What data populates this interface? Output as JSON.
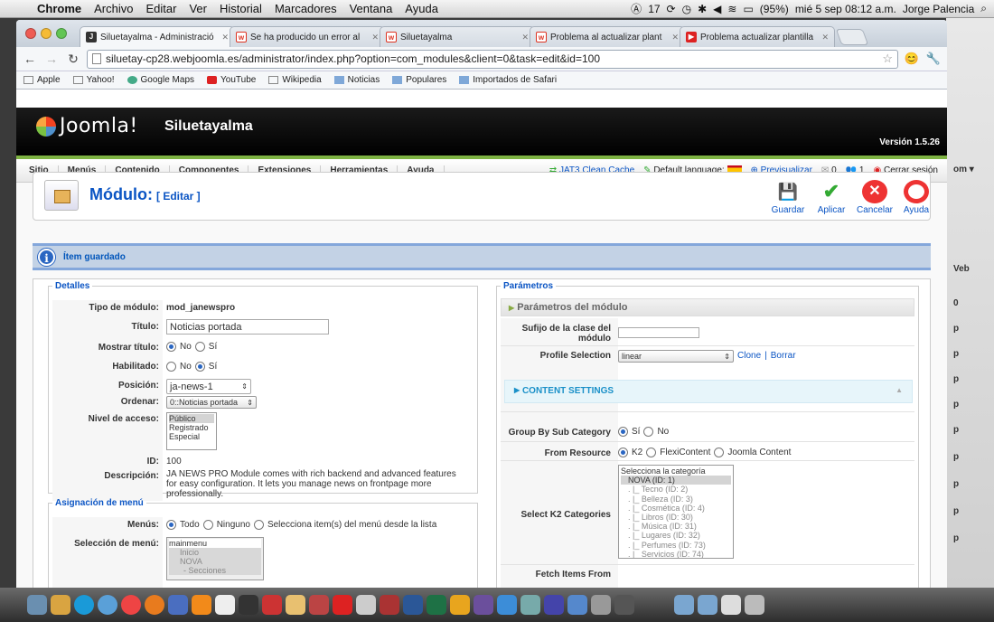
{
  "mac_menu": {
    "app": "Chrome",
    "items": [
      "Archivo",
      "Editar",
      "Ver",
      "Historial",
      "Marcadores",
      "Ventana",
      "Ayuda"
    ],
    "status": {
      "battery": "(95%)",
      "date": "mié 5 sep  08:12 a.m.",
      "user": "Jorge Palencia",
      "num": "17"
    }
  },
  "tabs": [
    {
      "title": "Siluetayalma - Administració",
      "icon": "joomla-favicon-icon"
    },
    {
      "title": "Se ha producido un error al",
      "icon": "w-favicon-icon"
    },
    {
      "title": "Siluetayalma",
      "icon": "w-favicon-icon"
    },
    {
      "title": "Problema al actualizar plant",
      "icon": "w-favicon-icon"
    },
    {
      "title": "Problema actualizar plantilla",
      "icon": "youtube-favicon-icon"
    }
  ],
  "url": "siluetay-cp28.webjoomla.es/administrator/index.php?option=com_modules&client=0&task=edit&id=100",
  "bookmarks": [
    "Apple",
    "Yahoo!",
    "Google Maps",
    "YouTube",
    "Wikipedia",
    "Noticias",
    "Populares",
    "Importados de Safari"
  ],
  "joomla": {
    "logo": "Joomla!",
    "site": "Siluetayalma",
    "version": "Versión 1.5.26",
    "menu": [
      "Sitio",
      "Menús",
      "Contenido",
      "Componentes",
      "Extensiones",
      "Herramientas",
      "Ayuda"
    ],
    "right": {
      "cache": "JAT3 Clean Cache",
      "lang": "Default language:",
      "preview": "Previsualizar",
      "msgs": "0",
      "users": "1",
      "logout": "Cerrar sesión"
    }
  },
  "toolbar": {
    "title": "Módulo:",
    "sub": "[ Editar ]",
    "save": "Guardar",
    "apply": "Aplicar",
    "cancel": "Cancelar",
    "help": "Ayuda"
  },
  "message": "Ítem guardado",
  "details": {
    "legend": "Detalles",
    "type_label": "Tipo de módulo:",
    "type": "mod_janewspro",
    "title_label": "Título:",
    "title": "Noticias portada",
    "show_title_label": "Mostrar título:",
    "no": "No",
    "yes": "Sí",
    "enabled_label": "Habilitado:",
    "position_label": "Posición:",
    "position": "ja-news-1",
    "order_label": "Ordenar:",
    "order": "0::Noticias portada",
    "access_label": "Nivel de acceso:",
    "access_options": [
      "Público",
      "Registrado",
      "Especial"
    ],
    "id_label": "ID:",
    "id": "100",
    "desc_label": "Descripción:",
    "desc": "JA NEWS PRO Module comes with rich backend and advanced features for easy configuration. It lets you manage news on frontpage more professionally."
  },
  "menu_assign": {
    "legend": "Asignación de menú",
    "menus_label": "Menús:",
    "all": "Todo",
    "none": "Ninguno",
    "select": "Selecciona item(s) del menú desde la lista",
    "selection_label": "Selección de menú:",
    "items": [
      "mainmenu",
      "Inicio",
      "NOVA",
      "- Secciones"
    ]
  },
  "params": {
    "legend": "Parámetros",
    "panel": "Parámetros del módulo",
    "suffix_label": "Sufijo de la clase del módulo",
    "profile_label": "Profile Selection",
    "profile": "linear",
    "clone": "Clone",
    "delete": "Borrar",
    "content_settings": "CONTENT SETTINGS",
    "group_label": "Group By Sub Category",
    "group_yes": "Sí",
    "group_no": "No",
    "resource_label": "From Resource",
    "res_k2": "K2",
    "res_flexi": "FlexiContent",
    "res_joomla": "Joomla Content",
    "cats_label": "Select K2 Categories",
    "cats": [
      "Selecciona la categoría",
      "NOVA (ID: 1)",
      ". |_ Tecno (ID: 2)",
      ". |_ Belleza (ID: 3)",
      ". |_ Cosmética (ID: 4)",
      ". |_ Libros (ID: 30)",
      ". |_ Música (ID: 31)",
      ". |_ Lugares (ID: 32)",
      ". |_ Perfumes (ID: 73)",
      ". |_ Servicios (ID: 74)"
    ],
    "fetch_label": "Fetch Items From"
  }
}
